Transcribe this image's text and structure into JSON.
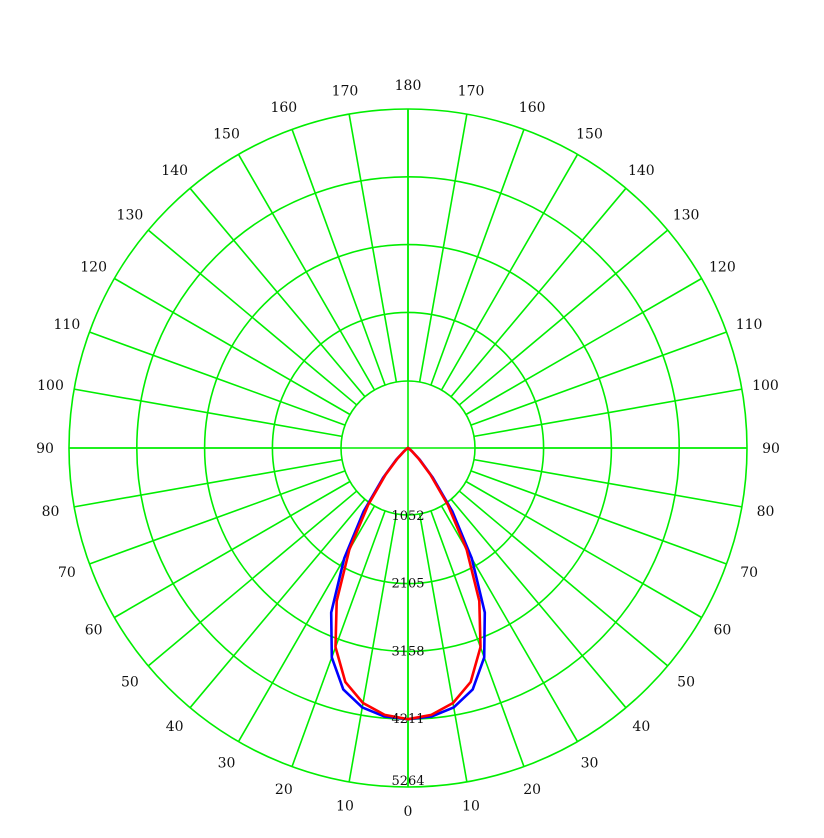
{
  "chart_data": {
    "type": "polar",
    "title": "",
    "angle_unit": "degrees",
    "angle_labels_right": [
      "0",
      "10",
      "20",
      "30",
      "40",
      "50",
      "60",
      "70",
      "80",
      "90",
      "100",
      "110",
      "120",
      "130",
      "140",
      "150",
      "160",
      "170",
      "180"
    ],
    "angle_labels_left": [
      "10",
      "20",
      "30",
      "40",
      "50",
      "60",
      "70",
      "80",
      "90",
      "100",
      "110",
      "120",
      "130",
      "140",
      "150",
      "160",
      "170"
    ],
    "radial_ticks": [
      1052,
      2105,
      3158,
      4211,
      5264
    ],
    "radial_tick_labels": [
      "1052",
      "2105",
      "3158",
      "4211",
      "5264"
    ],
    "radial_max": 5264,
    "grid": true,
    "colors": {
      "grid": "#00ee00",
      "series_blue": "#0000ff",
      "series_red": "#ff0000"
    },
    "series": [
      {
        "color": "#0000ff",
        "angles": [
          0,
          5,
          10,
          15,
          20,
          25,
          30,
          35,
          40,
          45,
          50,
          60,
          70,
          80,
          90
        ],
        "values": [
          4211,
          4185,
          4090,
          3880,
          3460,
          2820,
          1980,
          1200,
          600,
          260,
          90,
          20,
          5,
          0,
          0
        ]
      },
      {
        "color": "#ff0000",
        "angles": [
          0,
          5,
          10,
          15,
          20,
          25,
          30,
          35,
          40,
          45,
          50,
          60,
          70,
          80,
          90
        ],
        "values": [
          4211,
          4160,
          4020,
          3760,
          3290,
          2620,
          1820,
          1080,
          540,
          230,
          80,
          18,
          4,
          0,
          0
        ]
      }
    ]
  }
}
